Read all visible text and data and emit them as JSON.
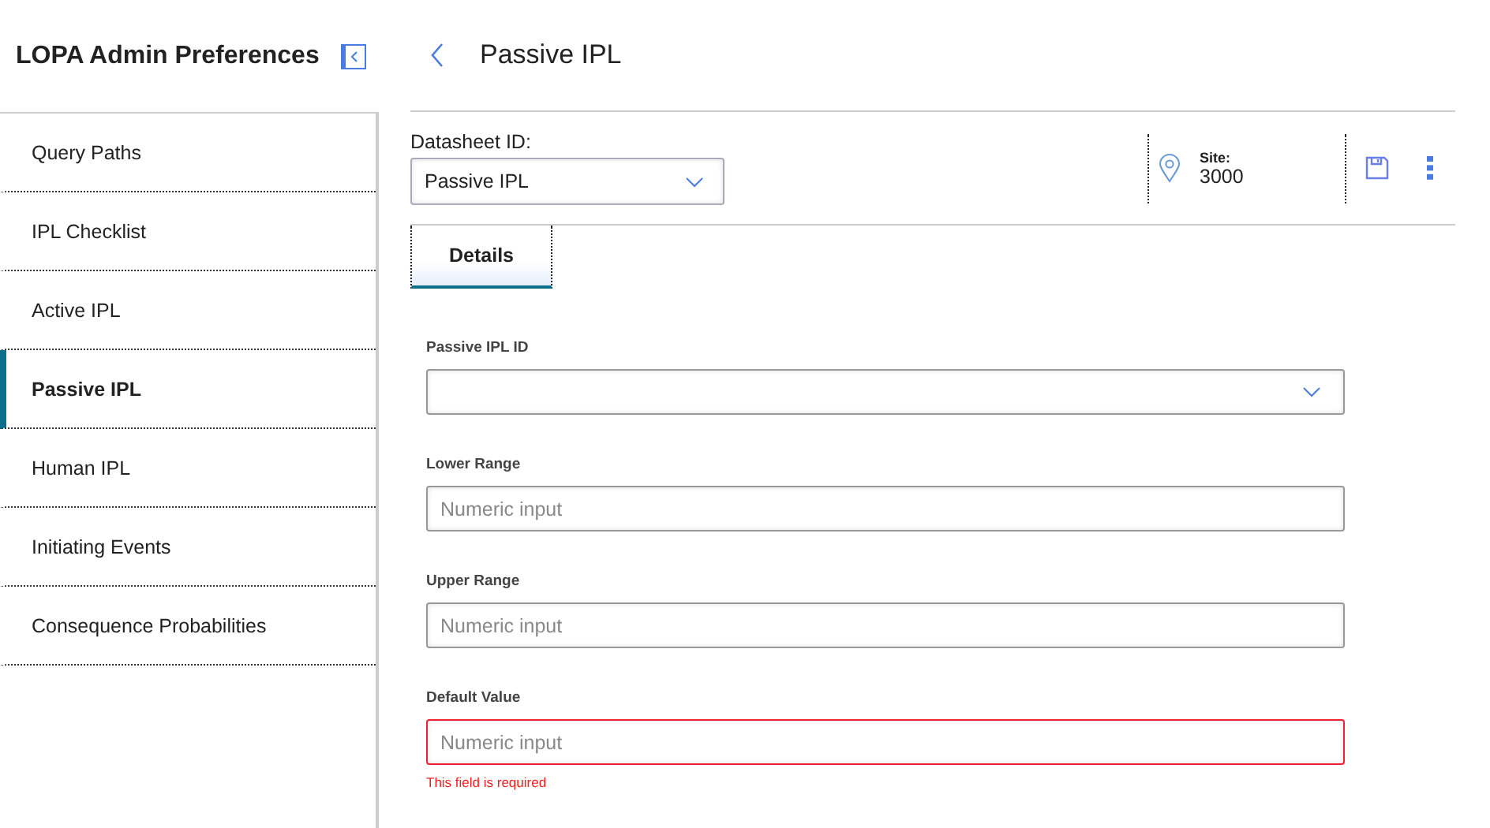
{
  "sidebar": {
    "title": "LOPA Admin Preferences",
    "items": [
      {
        "label": "Query Paths",
        "selected": false
      },
      {
        "label": "IPL Checklist",
        "selected": false
      },
      {
        "label": "Active IPL",
        "selected": false
      },
      {
        "label": "Passive IPL",
        "selected": true
      },
      {
        "label": "Human IPL",
        "selected": false
      },
      {
        "label": "Initiating Events",
        "selected": false
      },
      {
        "label": "Consequence Probabilities",
        "selected": false
      }
    ]
  },
  "header": {
    "title": "Passive IPL"
  },
  "datasheet": {
    "label": "Datasheet ID:",
    "value": "Passive IPL"
  },
  "site": {
    "label": "Site:",
    "value": "3000"
  },
  "tabs": [
    {
      "label": "Details",
      "selected": true
    }
  ],
  "fields": [
    {
      "kind": "select",
      "label": "Passive IPL ID",
      "error": false
    },
    {
      "kind": "number",
      "label": "Lower Range",
      "placeholder": "Numeric input",
      "error": false
    },
    {
      "kind": "number",
      "label": "Upper Range",
      "placeholder": "Numeric input",
      "error": false
    },
    {
      "kind": "number",
      "label": "Default Value",
      "placeholder": "Numeric input",
      "error": true,
      "message": "This field is required"
    }
  ]
}
